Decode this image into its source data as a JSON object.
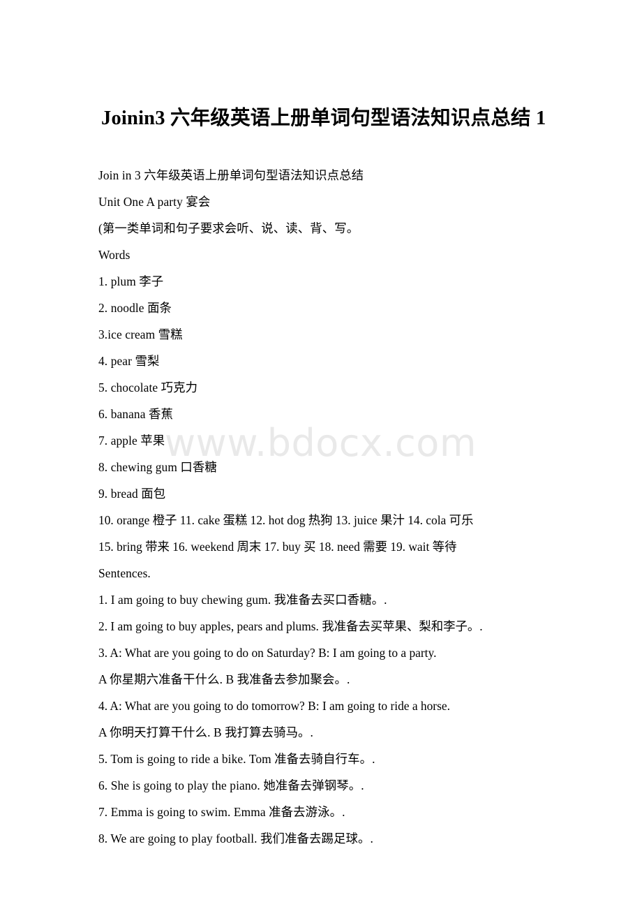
{
  "document": {
    "title": "Joinin3 六年级英语上册单词句型语法知识点总结 1",
    "watermark": "www.bdocx.com",
    "paragraphs": [
      "Join in 3 六年级英语上册单词句型语法知识点总结",
      "Unit One A party 宴会",
      "(第一类单词和句子要求会听、说、读、背、写。",
      "Words",
      "1. plum 李子",
      "2. noodle 面条",
      "3.ice cream 雪糕",
      "4. pear 雪梨",
      "5. chocolate 巧克力",
      "6. banana 香蕉",
      "7. apple 苹果",
      "8. chewing gum 口香糖",
      "9. bread 面包",
      "10. orange 橙子 11. cake 蛋糕 12. hot dog 热狗 13. juice 果汁 14. cola 可乐",
      "15. bring 带来 16. weekend 周末 17. buy 买 18. need 需要 19. wait 等待",
      "Sentences.",
      "1. I am going to buy chewing gum. 我准备去买口香糖。.",
      "2. I am going to buy apples, pears and plums. 我准备去买苹果、梨和李子。.",
      "3. A: What are you going to do on Saturday? B: I am going to a party.",
      "A 你星期六准备干什么. B 我准备去参加聚会。.",
      "4. A: What are you going to do tomorrow? B: I am going to ride a horse.",
      "A 你明天打算干什么. B 我打算去骑马。.",
      "5. Tom is going to ride a bike. Tom 准备去骑自行车。.",
      "6. She is going to play the piano. 她准备去弹钢琴。.",
      "7. Emma is going to swim. Emma 准备去游泳。.",
      "8. We are going to play football. 我们准备去踢足球。."
    ]
  }
}
